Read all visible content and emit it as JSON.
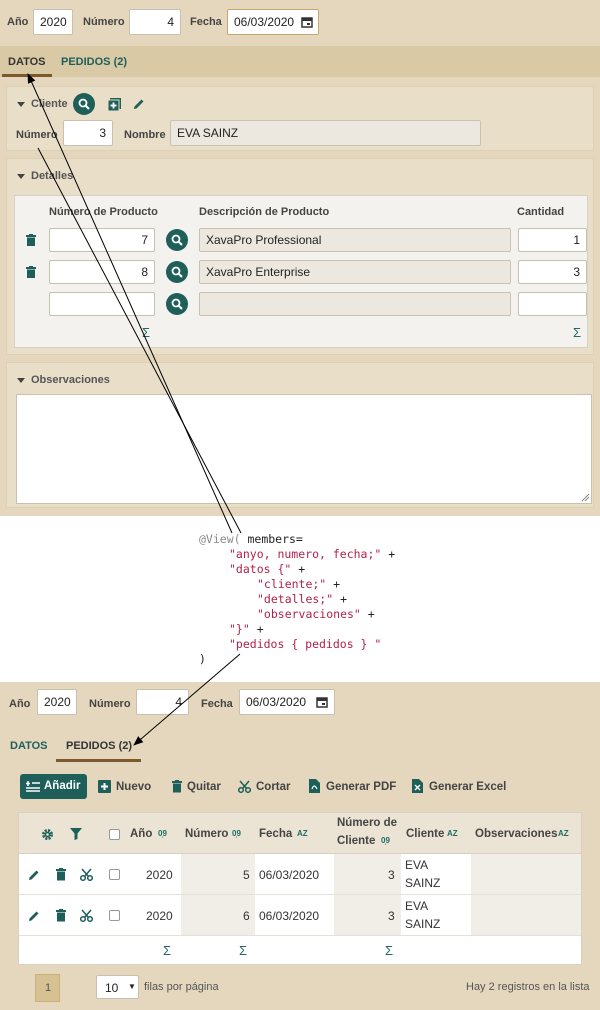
{
  "top_form": {
    "anyo_label": "Año",
    "anyo_value": "2020",
    "numero_label": "Número",
    "numero_value": "4",
    "fecha_label": "Fecha",
    "fecha_value": "06/03/2020"
  },
  "top_tabs": [
    {
      "label": "DATOS",
      "active": true
    },
    {
      "label": "PEDIDOS (2)",
      "active": false
    }
  ],
  "cliente_section": {
    "title": "Cliente",
    "numero_label": "Número",
    "numero_value": "3",
    "nombre_label": "Nombre",
    "nombre_value": "EVA SAINZ"
  },
  "detalles_section": {
    "title": "Detalles",
    "headers": {
      "numero": "Número de Producto",
      "descripcion": "Descripción de Producto",
      "cantidad": "Cantidad"
    },
    "rows": [
      {
        "numero": "7",
        "descripcion": "XavaPro Professional",
        "cantidad": "1"
      },
      {
        "numero": "8",
        "descripcion": "XavaPro Enterprise",
        "cantidad": "3"
      },
      {
        "numero": "",
        "descripcion": "",
        "cantidad": ""
      }
    ],
    "sum_symbol": "Σ"
  },
  "observaciones_section": {
    "title": "Observaciones",
    "value": ""
  },
  "code": {
    "l1_ann": "@View(",
    "l1_rest": " members=",
    "l2": "\"anyo, numero, fecha;\"",
    "l2_plus": " +",
    "l3": "\"datos {\"",
    "l3_plus": " +",
    "l4": "\"cliente;\"",
    "l4_plus": " +",
    "l5": "\"detalles;\"",
    "l5_plus": " +",
    "l6": "\"observaciones\"",
    "l6_plus": " +",
    "l7": "\"}\"",
    "l7_plus": " +",
    "l8": "\"pedidos { pedidos } \"",
    "l9": ")"
  },
  "bottom_form": {
    "anyo_label": "Año",
    "anyo_value": "2020",
    "numero_label": "Número",
    "numero_value": "4",
    "fecha_label": "Fecha",
    "fecha_value": "06/03/2020"
  },
  "bottom_tabs": [
    {
      "label": "DATOS",
      "active": false
    },
    {
      "label": "PEDIDOS (2)",
      "active": true
    }
  ],
  "toolbar": {
    "anadir": "Añadir",
    "nuevo": "Nuevo",
    "quitar": "Quitar",
    "cortar": "Cortar",
    "pdf": "Generar PDF",
    "excel": "Generar Excel"
  },
  "pedidos_table": {
    "headers": {
      "anyo": "Año",
      "numero": "Número",
      "fecha": "Fecha",
      "numero_cliente_1": "Número de",
      "numero_cliente_2": "Cliente",
      "cliente": "Cliente",
      "observaciones": "Observaciones"
    },
    "rows": [
      {
        "anyo": "2020",
        "numero": "5",
        "fecha": "06/03/2020",
        "numero_cliente": "3",
        "cliente_1": "EVA",
        "cliente_2": "SAINZ"
      },
      {
        "anyo": "2020",
        "numero": "6",
        "fecha": "06/03/2020",
        "numero_cliente": "3",
        "cliente_1": "EVA",
        "cliente_2": "SAINZ"
      }
    ],
    "sum_symbol": "Σ"
  },
  "pagination": {
    "page": "1",
    "page_size": "10",
    "per_page_label": "filas por página",
    "records_text": "Hay 2 registros en la lista"
  },
  "colors": {
    "accent": "#1f5f5a",
    "panel": "#e4d7bd",
    "tab_active_underline": "#7a5a2a"
  }
}
